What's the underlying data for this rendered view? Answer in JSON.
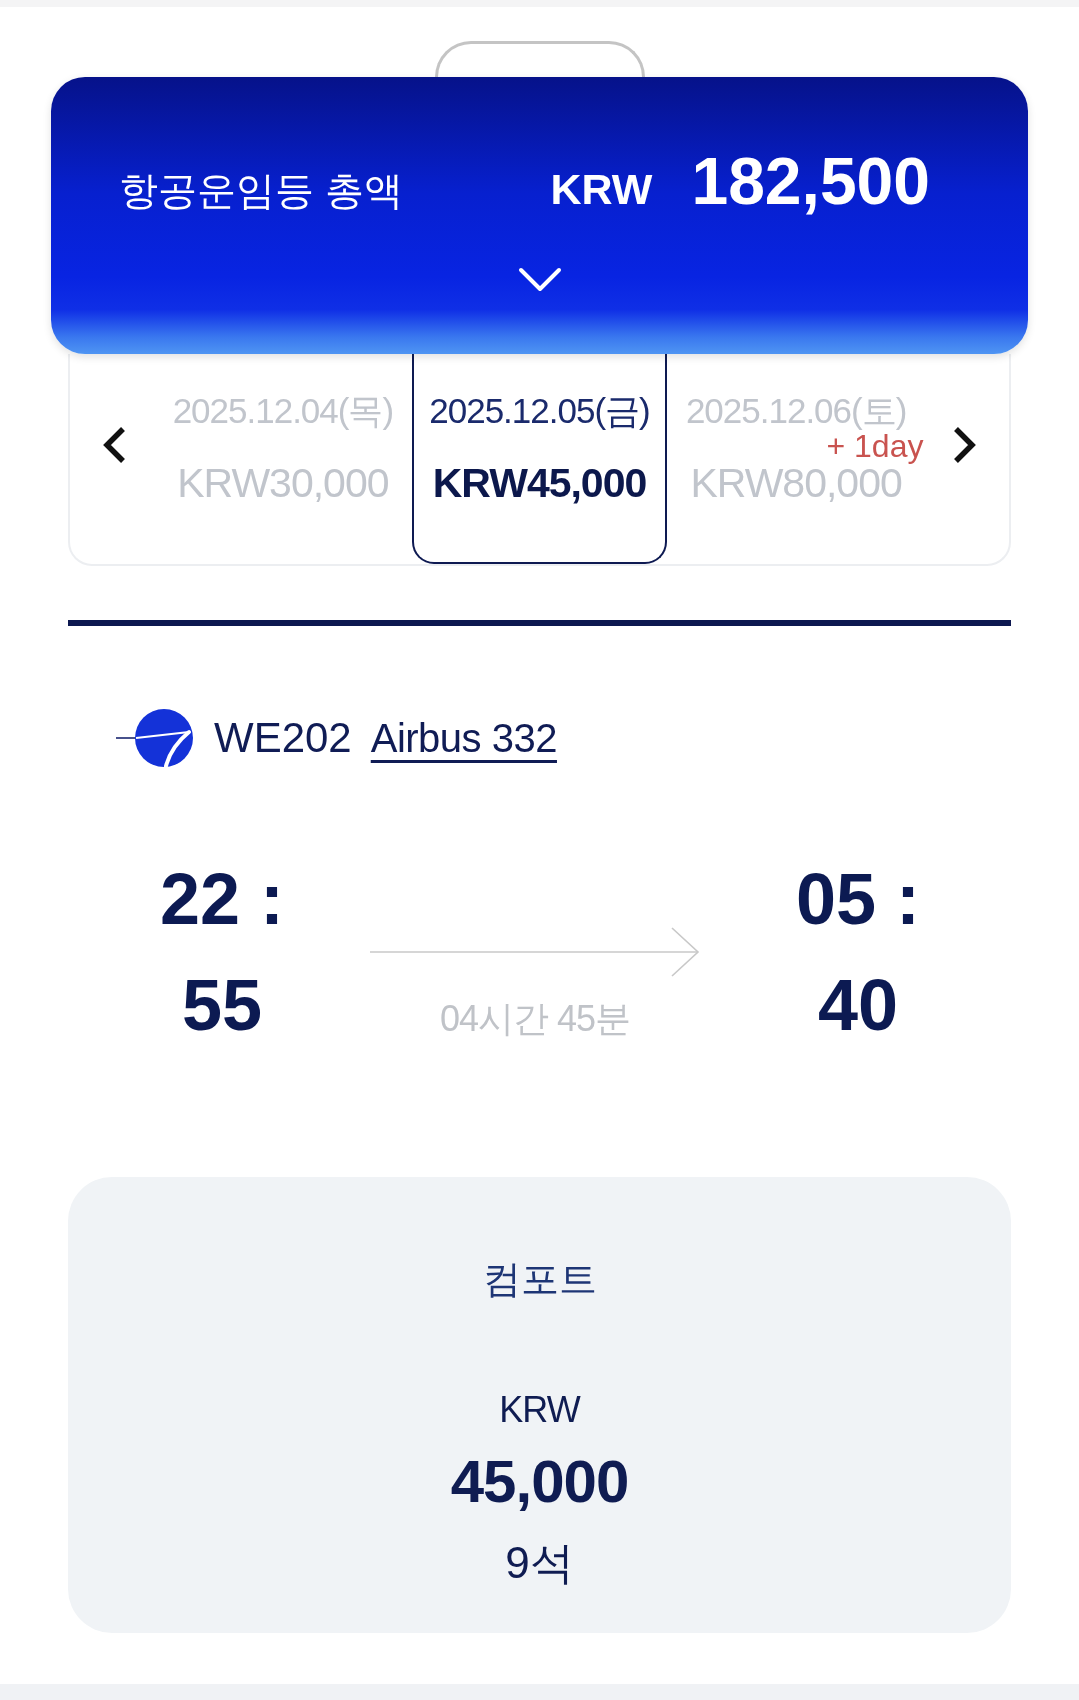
{
  "fare_total": {
    "label": "항공운임등 총액",
    "currency": "KRW",
    "amount": "182,500",
    "expanded": false
  },
  "date_selector": {
    "dates": [
      {
        "date": "2025.12.04(목)",
        "price": "KRW30,000",
        "selected": false
      },
      {
        "date": "2025.12.05(금)",
        "price": "KRW45,000",
        "selected": true
      },
      {
        "date": "2025.12.06(토)",
        "price": "KRW80,000",
        "selected": false,
        "note": "+ 1day"
      }
    ]
  },
  "flight": {
    "number": "WE202",
    "aircraft": "Airbus 332",
    "departure": "22 : 55",
    "arrival": "05 : 40",
    "duration": "04시간 45분"
  },
  "fare_classes": [
    {
      "name": "컴포트",
      "currency": "KRW",
      "price": "45,000",
      "seats": "9석"
    }
  ]
}
